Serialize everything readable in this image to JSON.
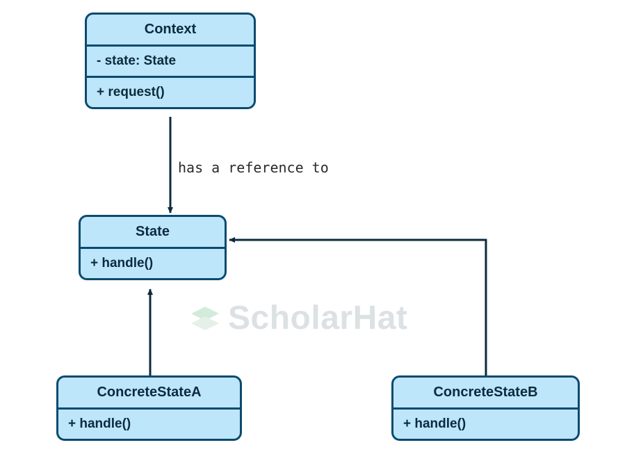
{
  "diagram": {
    "relation_label": "has a reference to",
    "boxes": {
      "context": {
        "title": "Context",
        "attr": "- state: State",
        "method": "+ request()"
      },
      "state": {
        "title": "State",
        "method": "+ handle()"
      },
      "concreteA": {
        "title": "ConcreteStateA",
        "method": "+ handle()"
      },
      "concreteB": {
        "title": "ConcreteStateB",
        "method": "+ handle()"
      }
    },
    "watermark": "ScholarHat"
  }
}
